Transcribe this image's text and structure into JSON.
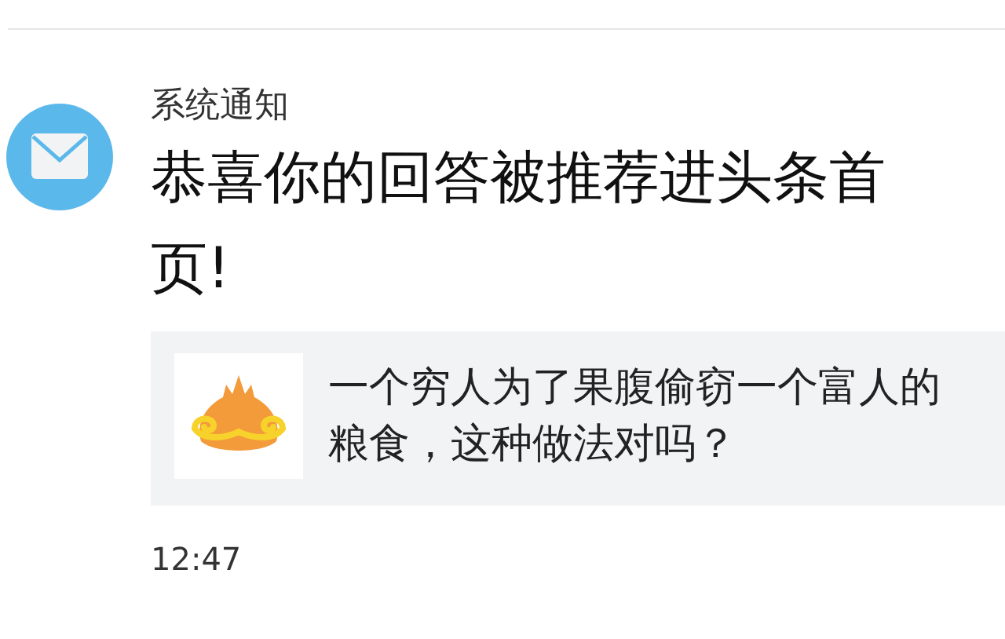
{
  "notification": {
    "sender": "系统通知",
    "message": "恭喜你的回答被推荐进头条首页!",
    "card": {
      "question": "一个穷人为了果腹偷窃一个富人的粮食，这种做法对吗？"
    },
    "time": "12:47"
  }
}
